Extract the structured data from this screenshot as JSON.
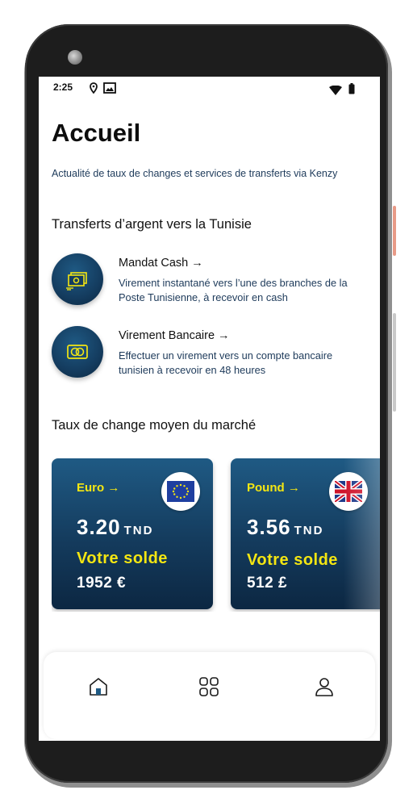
{
  "status_bar": {
    "time": "2:25",
    "icons": [
      "location-icon",
      "photo-icon",
      "wifi-icon",
      "battery-icon"
    ]
  },
  "page": {
    "title": "Accueil",
    "subtitle": "Actualité de taux de changes et services de transferts via Kenzy"
  },
  "transfers": {
    "section_title": "Transferts d’argent vers la Tunisie",
    "items": [
      {
        "title": "Mandat Cash →",
        "description": "Virement instantané vers l’une des branches de la Poste Tunisienne, à recevoir en cash",
        "icon": "cash-icon"
      },
      {
        "title": "Virement Bancaire →",
        "description": "Effectuer un virement vers un compte bancaire tunisien à recevoir en 48 heures",
        "icon": "bank-card-icon"
      }
    ]
  },
  "exchange": {
    "section_title": "Taux de change moyen du marché",
    "cards": [
      {
        "currency": "Euro →",
        "rate": "3.20",
        "unit": "TND",
        "balance_label": "Votre solde",
        "balance": "1952 €",
        "flag": "eu-flag-icon"
      },
      {
        "currency": "Pound →",
        "rate": "3.56",
        "unit": "TND",
        "balance_label": "Votre solde",
        "balance": "512 £",
        "flag": "uk-flag-icon"
      }
    ]
  },
  "bottom_nav": {
    "items": [
      "home-icon",
      "grid-icon",
      "profile-icon"
    ]
  },
  "colors": {
    "primary_dark": "#143b5d",
    "accent_yellow": "#f4e612",
    "text_blue": "#1d3a5a"
  }
}
